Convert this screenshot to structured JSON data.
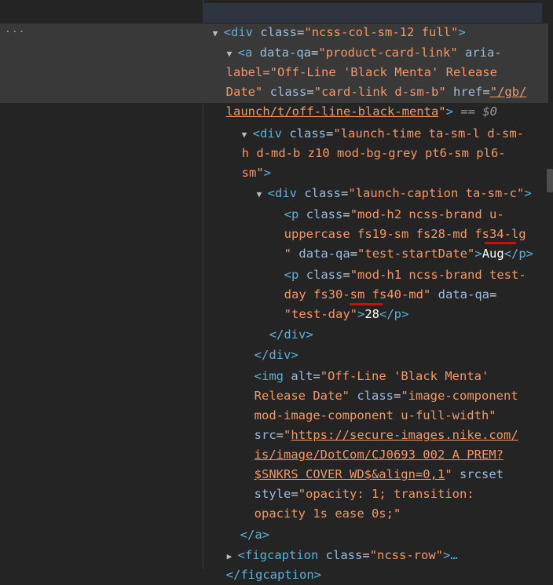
{
  "ellipsis": "...",
  "selected_suffix": "== $0",
  "lines": {
    "l1": {
      "open": "<div",
      "a1": "class",
      "v1": "\"ncss-col-sm-12 full\"",
      "close": ">"
    },
    "l2": {
      "open": "<a",
      "a1": "data-qa",
      "v1": "\"product-card-link\"",
      "a2": "aria-"
    },
    "l3": {
      "t": "label=\"Off-Line 'Black Menta' Release"
    },
    "l4": {
      "t1": "Date\"",
      "a1": "class",
      "v1": "\"card-link d-sm-b\"",
      "a2": "href",
      "v2": "\"/gb/"
    },
    "l5": {
      "v": "launch/t/off-line-black-menta",
      "q": "\"",
      "close": ">"
    },
    "l6": {
      "open": "<div",
      "a1": "class",
      "v1": "\"launch-time ta-sm-l d-sm-"
    },
    "l7": {
      "v": "h d-md-b z10 mod-bg-grey pt6-sm pl6-"
    },
    "l8": {
      "v": "sm\"",
      "close": ">"
    },
    "l9": {
      "open": "<div",
      "a1": "class",
      "v1": "\"launch-caption ta-sm-c\"",
      "close": ">"
    },
    "l10": {
      "open": "<p",
      "a1": "class",
      "v1": "\"mod-h2 ncss-brand u-"
    },
    "l11": {
      "v": "uppercase fs19-sm fs28-md fs34-lg"
    },
    "l12": {
      "v1": "\"",
      "a1": "data-qa",
      "v2": "\"test-startDate\"",
      "text": "Aug",
      "close": "</p>"
    },
    "l13": {
      "open": "<p",
      "a1": "class",
      "v1": "\"mod-h1 ncss-brand test-"
    },
    "l14": {
      "v1": "day fs30-sm fs40-md\"",
      "a1": "data-qa"
    },
    "l15": {
      "v1": "\"test-day\"",
      "text": "28",
      "close": "</p>"
    },
    "l16": {
      "close": "</div>"
    },
    "l17": {
      "close": "</div>"
    },
    "l18": {
      "open": "<img",
      "a1": "alt",
      "v1": "\"Off-Line 'Black Menta'"
    },
    "l19": {
      "v1": "Release Date\"",
      "a1": "class",
      "v2": "\"image-component"
    },
    "l20": {
      "v": "mod-image-component u-full-width\""
    },
    "l21": {
      "a1": "src",
      "v1": "\"",
      "link": "https://secure-images.nike.com/"
    },
    "l22": {
      "link": "is/image/DotCom/CJ0693 002 A PREM?"
    },
    "l23": {
      "link": "$SNKRS COVER WD$&align=0,1",
      "v2": "\"",
      "a2": "srcset"
    },
    "l24": {
      "a1": "style",
      "v1": "\"opacity: 1; transition:"
    },
    "l25": {
      "v": "opacity 1s ease 0s;\""
    },
    "l26": {
      "close": "</a>"
    },
    "l27": {
      "open": "<figcaption",
      "a1": "class",
      "v1": "\"ncss-row\"",
      "close": ">…"
    },
    "l28": {
      "close": "</figcaption>"
    }
  }
}
